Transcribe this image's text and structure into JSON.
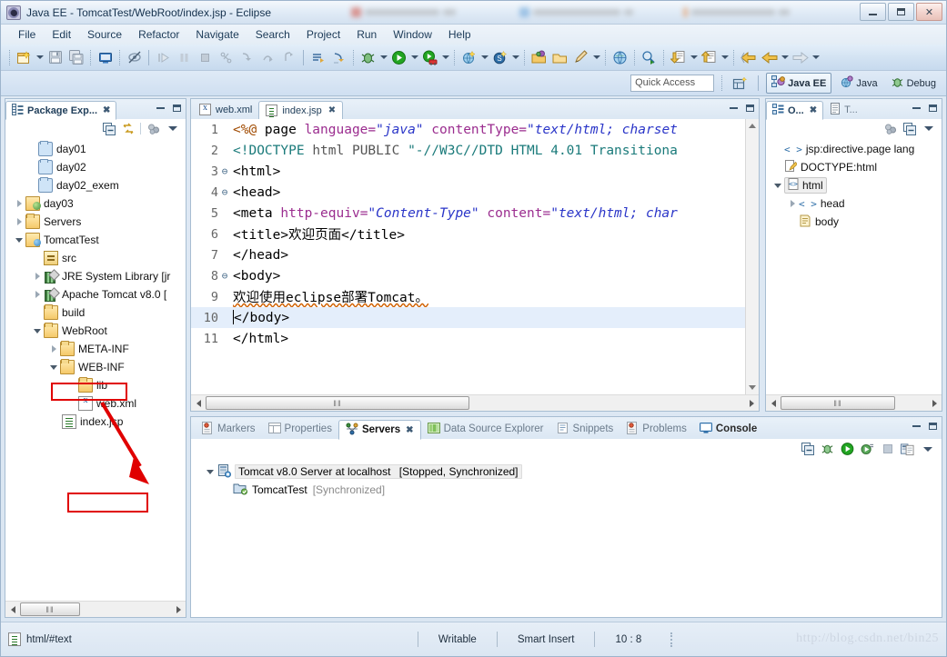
{
  "window": {
    "title": "Java EE - TomcatTest/WebRoot/index.jsp - Eclipse",
    "app_icon": "eclipse-icon",
    "minimize_label": "Minimize",
    "maximize_label": "Maximize",
    "close_label": "✕"
  },
  "menubar": {
    "items": [
      {
        "label": "File"
      },
      {
        "label": "Edit"
      },
      {
        "label": "Source"
      },
      {
        "label": "Refactor"
      },
      {
        "label": "Navigate"
      },
      {
        "label": "Search"
      },
      {
        "label": "Project"
      },
      {
        "label": "Run"
      },
      {
        "label": "Window"
      },
      {
        "label": "Help"
      }
    ]
  },
  "toolbar": {
    "groups": [
      {
        "icons": [
          "new-wizard-icon",
          "new-dropdown-arrow",
          "save-icon",
          "save-all-icon"
        ]
      },
      {
        "icons": [
          "new-jsp-file-icon"
        ]
      },
      {
        "icons": [
          "hide-skipped-icon"
        ]
      },
      {
        "icons": [
          "resume-icon",
          "suspend-icon",
          "terminate-icon",
          "disconnect-icon",
          "step-into-icon",
          "step-over-icon",
          "step-return-icon"
        ]
      },
      {
        "icons": [
          "next-annotation-icon",
          "previous-annotation-icon"
        ]
      },
      {
        "icons": [
          "debug-icon",
          "debug-dropdown-arrow",
          "run-icon",
          "run-dropdown-arrow",
          "run-server-icon",
          "server-dropdown-arrow"
        ]
      },
      {
        "icons": [
          "new-java-project-icon",
          "java-dropdown-arrow",
          "new-javascript-icon",
          "js-dropdown-arrow"
        ]
      },
      {
        "icons": [
          "open-type-icon",
          "open-task-icon",
          "edit-icon",
          "edit-dropdown-arrow"
        ]
      },
      {
        "icons": [
          "web-browser-icon",
          "search-icon"
        ]
      },
      {
        "icons": [
          "previous-edit-icon",
          "prev-dropdown-arrow",
          "next-edit-icon",
          "next-dropdown-arrow"
        ]
      },
      {
        "icons": [
          "back-icon",
          "back-dropdown-arrow",
          "forward-icon",
          "forward-dropdown-arrow"
        ]
      }
    ]
  },
  "perspective_bar": {
    "quick_access_placeholder": "Quick Access",
    "open_perspective_icon": "open-perspective-icon",
    "perspectives": [
      {
        "label": "Java EE",
        "icon": "java-ee-perspective-icon",
        "active": true
      },
      {
        "label": "Java",
        "icon": "java-perspective-icon",
        "active": false
      },
      {
        "label": "Debug",
        "icon": "debug-perspective-icon",
        "active": false
      }
    ]
  },
  "package_explorer": {
    "tab_label": "Package Exp...",
    "tab_icon": "package-explorer-icon",
    "close_glyph": "✖",
    "toolbar_icons": [
      "collapse-all-icon",
      "link-with-editor-icon",
      "view-menu-filter-icon",
      "view-menu-icon"
    ],
    "tree": [
      {
        "label": "day01",
        "indent": 0,
        "twist": "none",
        "icon": "folder-plain-icon"
      },
      {
        "label": "day02",
        "indent": 0,
        "twist": "none",
        "icon": "folder-plain-icon"
      },
      {
        "label": "day02_exem",
        "indent": 0,
        "twist": "none",
        "icon": "folder-plain-icon"
      },
      {
        "label": "day03",
        "indent": 0,
        "twist": "collapsed",
        "icon": "java-project-icon"
      },
      {
        "label": "Servers",
        "indent": 0,
        "twist": "collapsed",
        "icon": "folder-open-icon"
      },
      {
        "label": "TomcatTest",
        "indent": 0,
        "twist": "expanded",
        "icon": "web-project-icon"
      },
      {
        "label": "src",
        "indent": 1,
        "twist": "none",
        "icon": "source-folder-icon"
      },
      {
        "label": "JRE System Library [jr",
        "indent": 1,
        "twist": "collapsed",
        "icon": "library-icon"
      },
      {
        "label": "Apache Tomcat v8.0 [",
        "indent": 1,
        "twist": "collapsed",
        "icon": "library-icon"
      },
      {
        "label": "build",
        "indent": 1,
        "twist": "none",
        "icon": "folder-open-icon"
      },
      {
        "label": "WebRoot",
        "indent": 1,
        "twist": "expanded",
        "icon": "folder-open-icon",
        "highlight": true
      },
      {
        "label": "META-INF",
        "indent": 2,
        "twist": "collapsed",
        "icon": "folder-open-icon"
      },
      {
        "label": "WEB-INF",
        "indent": 2,
        "twist": "expanded",
        "icon": "folder-open-icon"
      },
      {
        "label": "lib",
        "indent": 3,
        "twist": "none",
        "icon": "folder-open-icon"
      },
      {
        "label": "web.xml",
        "indent": 3,
        "twist": "none",
        "icon": "xml-file-icon"
      },
      {
        "label": "index.jsp",
        "indent": 2,
        "twist": "none",
        "icon": "jsp-file-icon",
        "highlight": true
      }
    ],
    "annotation_color": "#e00000",
    "scroll_thumb_glyph": "‖‖"
  },
  "editor": {
    "tabs": [
      {
        "label": "web.xml",
        "icon": "xml-file-icon",
        "active": false,
        "close": ""
      },
      {
        "label": "index.jsp",
        "icon": "jsp-file-icon",
        "active": true,
        "close": "✖"
      }
    ],
    "lines": [
      {
        "num": "1",
        "fold": "",
        "highlight": false,
        "tokens": [
          {
            "t": "<%@ ",
            "c": "k-dir"
          },
          {
            "t": "page ",
            "c": "k-plain"
          },
          {
            "t": "language=",
            "c": "k-attr"
          },
          {
            "t": "\"java\"",
            "c": "k-str"
          },
          {
            "t": " contentType=",
            "c": "k-attr"
          },
          {
            "t": "\"text/html; charset",
            "c": "k-str"
          }
        ]
      },
      {
        "num": "2",
        "fold": "",
        "highlight": false,
        "tokens": [
          {
            "t": "<!DOCTYPE ",
            "c": "k-doc"
          },
          {
            "t": "html PUBLIC ",
            "c": "k-grey"
          },
          {
            "t": "\"-//W3C//DTD HTML 4.01 Transitiona",
            "c": "k-doc"
          }
        ]
      },
      {
        "num": "3",
        "fold": "⊖",
        "highlight": false,
        "tokens": [
          {
            "t": "<html>",
            "c": "k-plain"
          }
        ]
      },
      {
        "num": "4",
        "fold": "⊖",
        "highlight": false,
        "tokens": [
          {
            "t": "<head>",
            "c": "k-plain"
          }
        ]
      },
      {
        "num": "5",
        "fold": "",
        "highlight": false,
        "tokens": [
          {
            "t": "<meta ",
            "c": "k-plain"
          },
          {
            "t": "http-equiv=",
            "c": "k-attr"
          },
          {
            "t": "\"Content-Type\"",
            "c": "k-str"
          },
          {
            "t": " content=",
            "c": "k-attr"
          },
          {
            "t": "\"text/html; char",
            "c": "k-str"
          }
        ]
      },
      {
        "num": "6",
        "fold": "",
        "highlight": false,
        "tokens": [
          {
            "t": "<title>欢迎页面</title>",
            "c": "k-plain"
          }
        ]
      },
      {
        "num": "7",
        "fold": "",
        "highlight": false,
        "tokens": [
          {
            "t": "</head>",
            "c": "k-plain"
          }
        ]
      },
      {
        "num": "8",
        "fold": "⊖",
        "highlight": false,
        "tokens": [
          {
            "t": "<body>",
            "c": "k-plain"
          }
        ]
      },
      {
        "num": "9",
        "fold": "",
        "highlight": false,
        "tokens": [
          {
            "t": "欢迎使用eclipse部署Tomcat。",
            "c": "k-plain"
          }
        ]
      },
      {
        "num": "10",
        "fold": "",
        "highlight": true,
        "tokens": [
          {
            "t": "</body>",
            "c": "k-plain"
          }
        ]
      },
      {
        "num": "11",
        "fold": "",
        "highlight": false,
        "tokens": [
          {
            "t": "</html>",
            "c": "k-plain"
          }
        ]
      }
    ],
    "hscroll_thumb_glyph": "‖‖"
  },
  "outline": {
    "tabs": [
      {
        "label": "O...",
        "icon": "outline-icon",
        "active": true,
        "close": "✖"
      },
      {
        "label": "T...",
        "icon": "task-list-icon",
        "active": false,
        "close": ""
      }
    ],
    "toolbar_icons": [
      "view-menu-filter-icon",
      "collapse-all-icon",
      "view-menu-icon"
    ],
    "tree": [
      {
        "label": "jsp:directive.page lang",
        "indent": 0,
        "twist": "none",
        "icon": "element-icon"
      },
      {
        "label": "DOCTYPE:html",
        "indent": 0,
        "twist": "none",
        "icon": "doctype-icon"
      },
      {
        "label": "html",
        "indent": 0,
        "twist": "expanded",
        "icon": "html-element-icon",
        "selected": true
      },
      {
        "label": "head",
        "indent": 1,
        "twist": "collapsed",
        "icon": "element-icon"
      },
      {
        "label": "body",
        "indent": 1,
        "twist": "none",
        "icon": "text-element-icon"
      }
    ],
    "hscroll_thumb_glyph": "‖‖"
  },
  "bottom_panel": {
    "tabs": [
      {
        "label": "Markers",
        "icon": "markers-icon",
        "active": false,
        "close": ""
      },
      {
        "label": "Properties",
        "icon": "properties-icon",
        "active": false,
        "close": ""
      },
      {
        "label": "Servers",
        "icon": "servers-icon",
        "active": true,
        "close": "✖"
      },
      {
        "label": "Data Source Explorer",
        "icon": "data-source-explorer-icon",
        "active": false,
        "close": ""
      },
      {
        "label": "Snippets",
        "icon": "snippets-icon",
        "active": false,
        "close": ""
      },
      {
        "label": "Problems",
        "icon": "problems-icon",
        "active": false,
        "close": ""
      },
      {
        "label": "Console",
        "icon": "console-icon",
        "active": false,
        "close": "",
        "bold": true
      }
    ],
    "toolbar_icons": [
      "collapse-all-icon",
      "debug-server-icon",
      "start-server-icon",
      "profile-server-icon",
      "stop-server-icon",
      "publish-icon",
      "view-menu-icon"
    ],
    "servers": [
      {
        "name": "Tomcat v8.0 Server at localhost",
        "status": "[Stopped, Synchronized]",
        "icon": "server-icon",
        "twist": "expanded",
        "selected": true,
        "indent": 0
      },
      {
        "name": "TomcatTest",
        "status": "[Synchronized]",
        "icon": "module-icon",
        "twist": "none",
        "selected": false,
        "indent": 1
      }
    ]
  },
  "statusbar": {
    "selection_icon": "jsp-file-icon",
    "selection_text": "html/#text",
    "writable": "Writable",
    "insert_mode": "Smart Insert",
    "cursor_position": "10 : 8",
    "watermark": "http://blog.csdn.net/bin25"
  }
}
